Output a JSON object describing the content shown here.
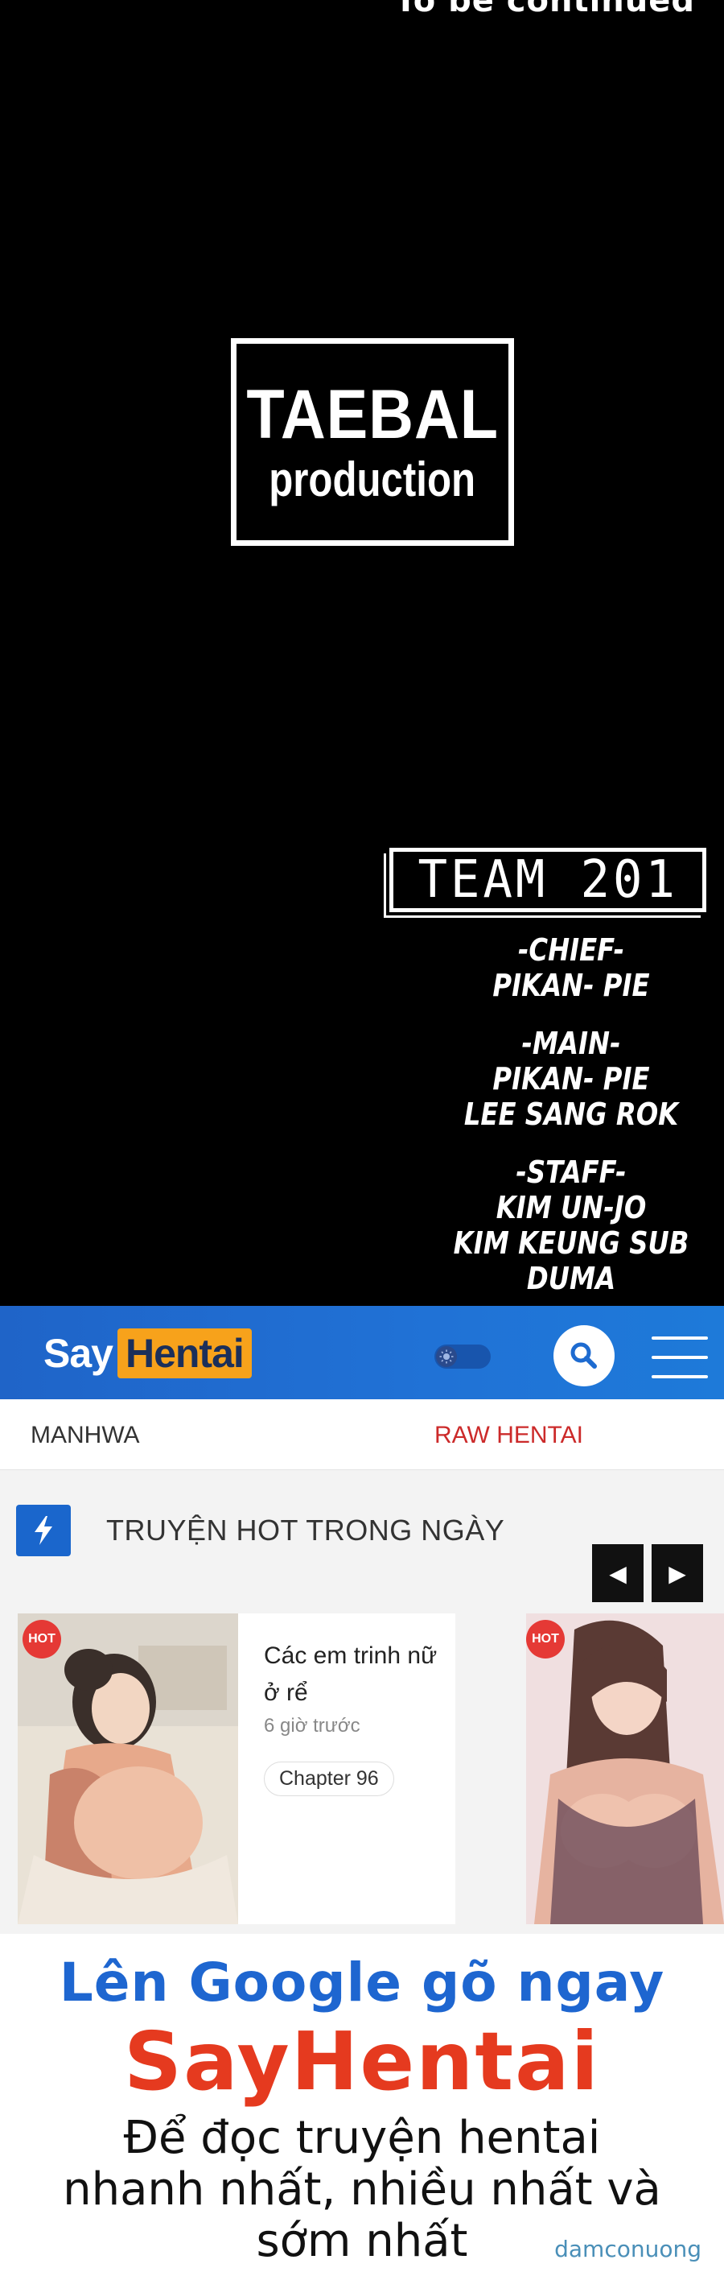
{
  "comic": {
    "to_be_continued": "To be continued",
    "studio_title": "TAEBAL",
    "studio_subtitle": "production",
    "team_title": "TEAM 201",
    "credits": [
      {
        "role": "-CHIEF-",
        "names": [
          "PIKAN- PIE"
        ]
      },
      {
        "role": "-MAIN-",
        "names": [
          "PIKAN- PIE",
          "LEE SANG ROK"
        ]
      },
      {
        "role": "-STAFF-",
        "names": [
          "KIM UN-JO",
          "KIM KEUNG SUB",
          "DUMA"
        ]
      }
    ]
  },
  "header": {
    "logo_part1": "Say",
    "logo_part2": "Hentai",
    "toggle_icon": "sun-icon",
    "search_icon": "search-icon",
    "menu_icon": "hamburger-icon"
  },
  "nav": {
    "items": [
      {
        "label": "MANHWA"
      },
      {
        "label": "RAW HENTAI"
      }
    ]
  },
  "section": {
    "title": "TRUYỆN HOT TRONG NGÀY",
    "icon": "bolt-icon",
    "prev_icon": "chevron-left-icon",
    "next_icon": "chevron-right-icon",
    "prev_glyph": "◀",
    "next_glyph": "▶"
  },
  "cards": [
    {
      "badge": "HOT",
      "title": "Các em trinh nữ ở rể",
      "time": "6 giờ trước",
      "chapter": "Chapter 96"
    },
    {
      "badge": "HOT"
    }
  ],
  "promo": {
    "line1": "Lên Google gõ ngay",
    "line2": "SayHentai",
    "line3a": "Để đọc truyện hentai",
    "line3b": "nhanh nhất, nhiều nhất và",
    "line3c": "sớm nhất",
    "watermark": "damconuong"
  },
  "colors": {
    "header_blue": "#2072d6",
    "logo_orange": "#f7a21b",
    "hot_red": "#e53935",
    "promo_blue": "#1e66d0",
    "promo_red": "#e53a1f",
    "raw_hentai_red": "#cc2a2a"
  }
}
